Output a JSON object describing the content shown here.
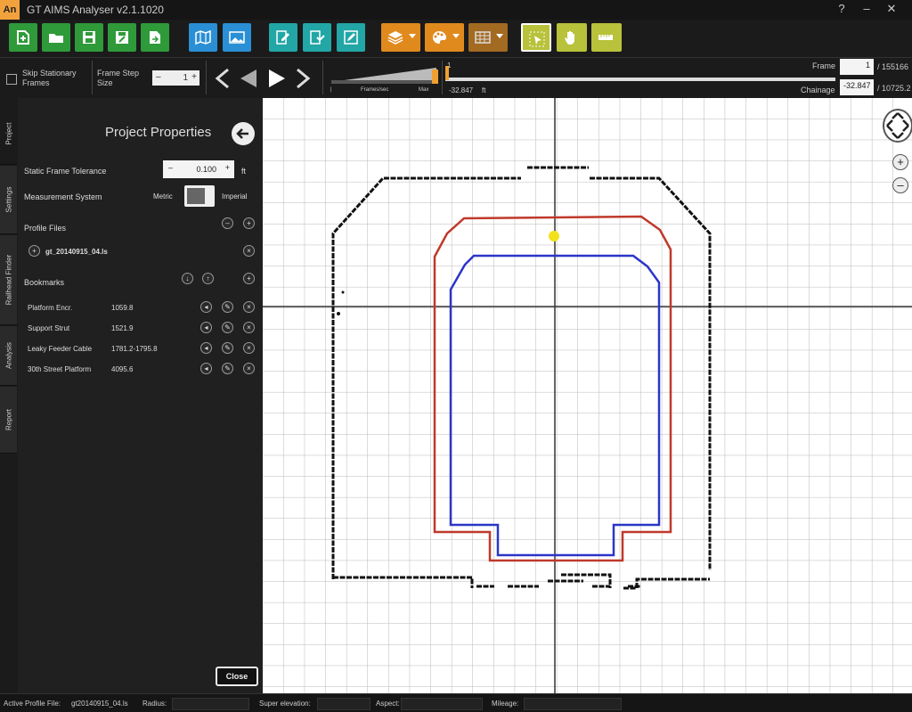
{
  "app": {
    "badge": "An",
    "title": "GT AIMS Analyser v2.1.1020",
    "help": "?",
    "minimize": "–",
    "close": "✕"
  },
  "colors": {
    "green": "#2f9a3a",
    "blue": "#2a8fd4",
    "teal": "#22a6a6",
    "orange": "#e08a1e",
    "olive": "#b8c23a",
    "profile_red": "#c0392b",
    "profile_blue": "#2b35c8",
    "marker": "#f2e21c"
  },
  "toolbar": {
    "buttons": [
      "new-project",
      "open-project",
      "save",
      "save-as",
      "export",
      "map-view",
      "image-view",
      "edit-profile-1",
      "edit-profile-2",
      "edit-profile-3",
      "layers",
      "palette",
      "display-options",
      "select-tool",
      "pan-tool",
      "measure-tool"
    ]
  },
  "nav": {
    "skip_stationary": "Skip Stationary Frames",
    "frame_step_label": "Frame Step Size",
    "frame_step_value": "1",
    "fps_label_left": "Frames/sec",
    "fps_label_right": "Max",
    "progress_fraction": 0.0,
    "frame_track_start": "1",
    "frame_track_value": "-32.847",
    "frame_track_unit": "ft",
    "frame_label": "Frame",
    "frame_value": "1",
    "frame_total": "/ 155166",
    "chainage_label": "Chainage",
    "chainage_value": "-32.847",
    "chainage_total": "/ 10725.2"
  },
  "side_tabs": [
    "Project",
    "Settings",
    "Railhead Finder",
    "Analysis",
    "Report"
  ],
  "panel": {
    "title": "Project Properties",
    "static_frame_tolerance_label": "Static Frame Tolerance",
    "static_frame_tolerance_value": "0.100",
    "static_frame_tolerance_unit": "ft",
    "measurement_system_label": "Measurement System",
    "metric_label": "Metric",
    "imperial_label": "Imperial",
    "profile_files_label": "Profile Files",
    "profile_file": "gt_20140915_04.ls",
    "bookmarks_label": "Bookmarks",
    "bookmarks": [
      {
        "name": "Platform Encr.",
        "value": "1059.8"
      },
      {
        "name": "Support Strut",
        "value": "1521.9"
      },
      {
        "name": "Leaky Feeder Cable",
        "value": "1781.2-1795.8"
      },
      {
        "name": "30th Street Platform",
        "value": "4095.6"
      }
    ],
    "close_button": "Close"
  },
  "status": {
    "active_profile_label": "Active Profile File:",
    "active_profile_value": "gt20140915_04.ls",
    "radius_label": "Radius:",
    "super_elevation_label": "Super elevation:",
    "aspect_label": "Aspect:",
    "mileage_label": "Mileage:"
  }
}
